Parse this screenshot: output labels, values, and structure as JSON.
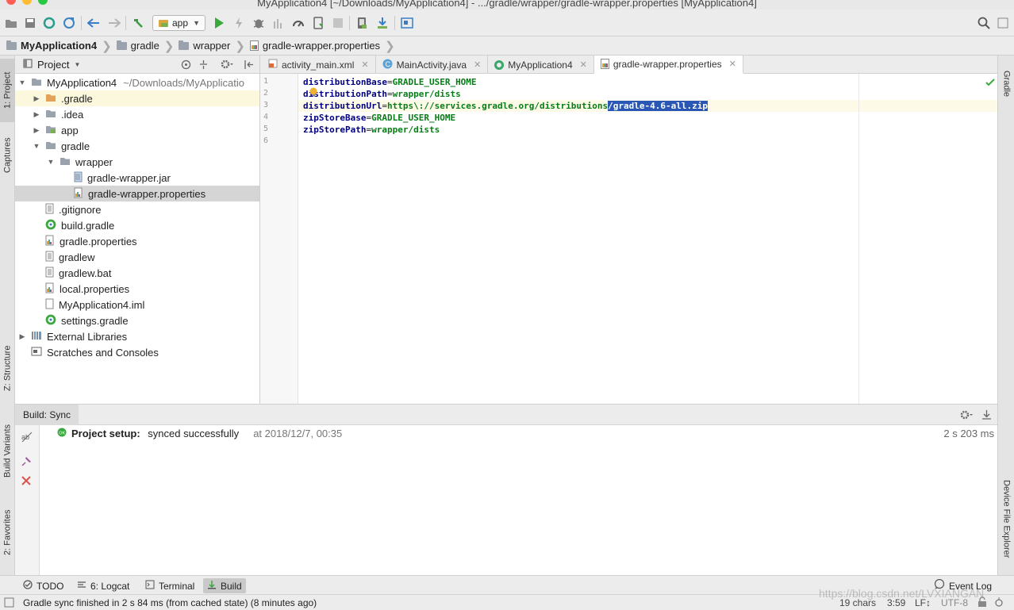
{
  "window": {
    "title": "MyApplication4 [~/Downloads/MyApplication4] - .../gradle/wrapper/gradle-wrapper.properties [MyApplication4]"
  },
  "toolbar": {
    "run_config": "app",
    "icons": [
      "open-icon",
      "save-icon",
      "sync-icon",
      "refresh-icon",
      "back-icon",
      "forward-icon",
      "hammer-icon",
      "run-icon",
      "apply-changes-icon",
      "debug-icon",
      "profile-icon",
      "attach-icon",
      "device-icon",
      "stop-icon",
      "avd-manager-icon",
      "sdk-manager-icon",
      "layout-inspector-icon",
      "search-icon"
    ]
  },
  "breadcrumb": [
    "MyApplication4",
    "gradle",
    "wrapper",
    "gradle-wrapper.properties"
  ],
  "left_stripe": {
    "project_tab": "1: Project",
    "captures_tab": "Captures",
    "structure_tab": "Z: Structure",
    "build_variants_tab": "Build Variants",
    "favorites_tab": "2: Favorites"
  },
  "right_stripe": {
    "gradle_tab": "Gradle",
    "device_file_explorer_tab": "Device File Explorer"
  },
  "project_panel": {
    "view_mode": "Project",
    "tree": [
      {
        "label": "MyApplication4",
        "suffix": "~/Downloads/MyApplicatio",
        "depth": 0,
        "arrow": "down",
        "icon": "folder"
      },
      {
        "label": ".gradle",
        "depth": 1,
        "arrow": "right",
        "icon": "folder-orange"
      },
      {
        "label": ".idea",
        "depth": 1,
        "arrow": "right",
        "icon": "folder"
      },
      {
        "label": "app",
        "depth": 1,
        "arrow": "right",
        "icon": "folder-module"
      },
      {
        "label": "gradle",
        "depth": 1,
        "arrow": "down",
        "icon": "folder"
      },
      {
        "label": "wrapper",
        "depth": 2,
        "arrow": "down",
        "icon": "folder"
      },
      {
        "label": "gradle-wrapper.jar",
        "depth": 3,
        "arrow": "",
        "icon": "jar"
      },
      {
        "label": "gradle-wrapper.properties",
        "depth": 3,
        "arrow": "",
        "icon": "properties"
      },
      {
        "label": ".gitignore",
        "depth": 1,
        "arrow": "",
        "icon": "text"
      },
      {
        "label": "build.gradle",
        "depth": 1,
        "arrow": "",
        "icon": "gradle"
      },
      {
        "label": "gradle.properties",
        "depth": 1,
        "arrow": "",
        "icon": "properties"
      },
      {
        "label": "gradlew",
        "depth": 1,
        "arrow": "",
        "icon": "text"
      },
      {
        "label": "gradlew.bat",
        "depth": 1,
        "arrow": "",
        "icon": "text"
      },
      {
        "label": "local.properties",
        "depth": 1,
        "arrow": "",
        "icon": "properties"
      },
      {
        "label": "MyApplication4.iml",
        "depth": 1,
        "arrow": "",
        "icon": "iml"
      },
      {
        "label": "settings.gradle",
        "depth": 1,
        "arrow": "",
        "icon": "gradle"
      },
      {
        "label": "External Libraries",
        "depth": 0,
        "arrow": "right",
        "icon": "libraries"
      },
      {
        "label": "Scratches and Consoles",
        "depth": 0,
        "arrow": "",
        "icon": "scratches"
      }
    ]
  },
  "editor_tabs": [
    {
      "label": "activity_main.xml",
      "icon": "xml"
    },
    {
      "label": "MainActivity.java",
      "icon": "java"
    },
    {
      "label": "MyApplication4",
      "icon": "gradle"
    },
    {
      "label": "gradle-wrapper.properties",
      "icon": "properties",
      "active": true
    }
  ],
  "editor": {
    "line_numbers": [
      "1",
      "2",
      "3",
      "4",
      "5",
      "6"
    ],
    "lines": [
      {
        "key": "distributionBase",
        "eq": "=",
        "value": "GRADLE_USER_HOME",
        "selected": ""
      },
      {
        "key": "distributionPath",
        "eq": "=",
        "value": "wrapper/dists",
        "selected": ""
      },
      {
        "key": "distributionUrl",
        "eq": "=",
        "value": "https\\://services.gradle.org/distributions",
        "selected": "/gradle-4.6-all.zip"
      },
      {
        "key": "zipStoreBase",
        "eq": "=",
        "value": "GRADLE_USER_HOME",
        "selected": ""
      },
      {
        "key": "zipStorePath",
        "eq": "=",
        "value": "wrapper/dists",
        "selected": ""
      }
    ]
  },
  "build_panel": {
    "tab": "Build: Sync",
    "message_bold": "Project setup:",
    "message": " synced successfully",
    "timestamp": "at 2018/12/7, 00:35",
    "duration": "2 s 203 ms"
  },
  "bottom_tabs": [
    {
      "label": "TODO",
      "icon": "todo-icon"
    },
    {
      "label": "6: Logcat",
      "icon": "logcat-icon"
    },
    {
      "label": "Terminal",
      "icon": "terminal-icon"
    },
    {
      "label": "Build",
      "icon": "build-icon",
      "active": true
    }
  ],
  "event_log": "Event Log",
  "status_bar": {
    "message": "Gradle sync finished in 2 s 84 ms (from cached state) (8 minutes ago)",
    "chars": "19 chars",
    "position": "3:59",
    "line_sep": "LF↕",
    "encoding": "UTF-8",
    "watermark": "https://blog.csdn.net/LVXIANGAN"
  }
}
